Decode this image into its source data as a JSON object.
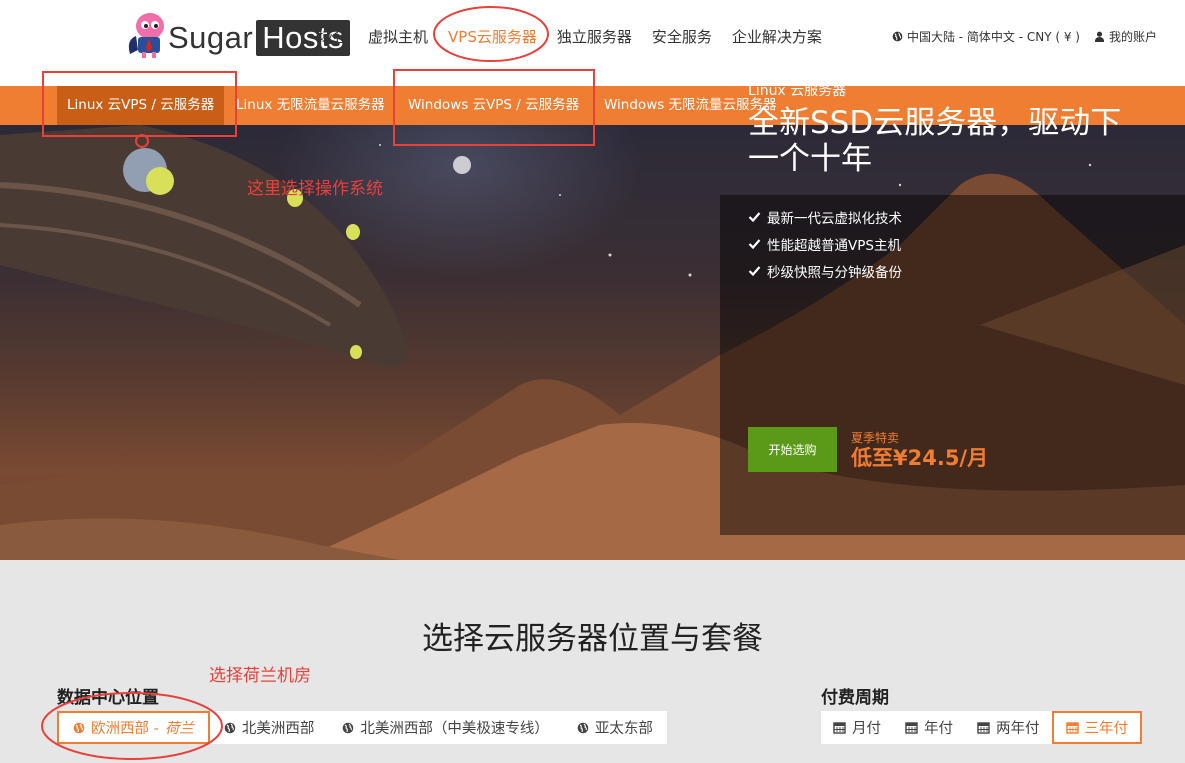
{
  "header": {
    "logo_text_1": "Sugar",
    "logo_text_2": "Hosts",
    "nav": [
      {
        "label": "域名"
      },
      {
        "label": "虚拟主机"
      },
      {
        "label": "VPS云服务器"
      },
      {
        "label": "独立服务器"
      },
      {
        "label": "安全服务"
      },
      {
        "label": "企业解决方案"
      }
    ],
    "region_label": "中国大陆 - 简体中文 - CNY ( ¥ )",
    "account_label": "我的账户"
  },
  "subnav": {
    "items": [
      {
        "label": "Linux 云VPS / 云服务器"
      },
      {
        "label": "Linux 无限流量云服务器"
      },
      {
        "label": "Windows 云VPS / 云服务器"
      },
      {
        "label": "Windows 无限流量云服务器"
      }
    ]
  },
  "hero": {
    "eyebrow": "Linux 云服务器",
    "title": "全新SSD云服务器，驱动下一个十年",
    "features": [
      "最新一代云虚拟化技术",
      "性能超越普通VPS主机",
      "秒级快照与分钟级备份"
    ],
    "cta_label": "开始选购",
    "promo_label": "夏季特卖",
    "promo_price": "低至¥24.5/月"
  },
  "annotations": {
    "os_note": "这里选择操作系统",
    "dc_note": "选择荷兰机房"
  },
  "plans": {
    "section_title": "选择云服务器位置与套餐",
    "location_label": "数据中心位置",
    "locations": [
      {
        "prefix": "欧洲西部 - ",
        "suffix": "荷兰"
      },
      {
        "prefix": "北美洲西部",
        "suffix": ""
      },
      {
        "prefix": "北美洲西部（中美极速专线）",
        "suffix": ""
      },
      {
        "prefix": "亚太东部",
        "suffix": ""
      }
    ],
    "billing_label": "付费周期",
    "billing": [
      {
        "label": "月付"
      },
      {
        "label": "年付"
      },
      {
        "label": "两年付"
      },
      {
        "label": "三年付"
      }
    ]
  },
  "colors": {
    "accent": "#ef7d32",
    "accent_dark": "#c95f17",
    "cta_green": "#5a9a18",
    "annotation_red": "#e8403a"
  }
}
